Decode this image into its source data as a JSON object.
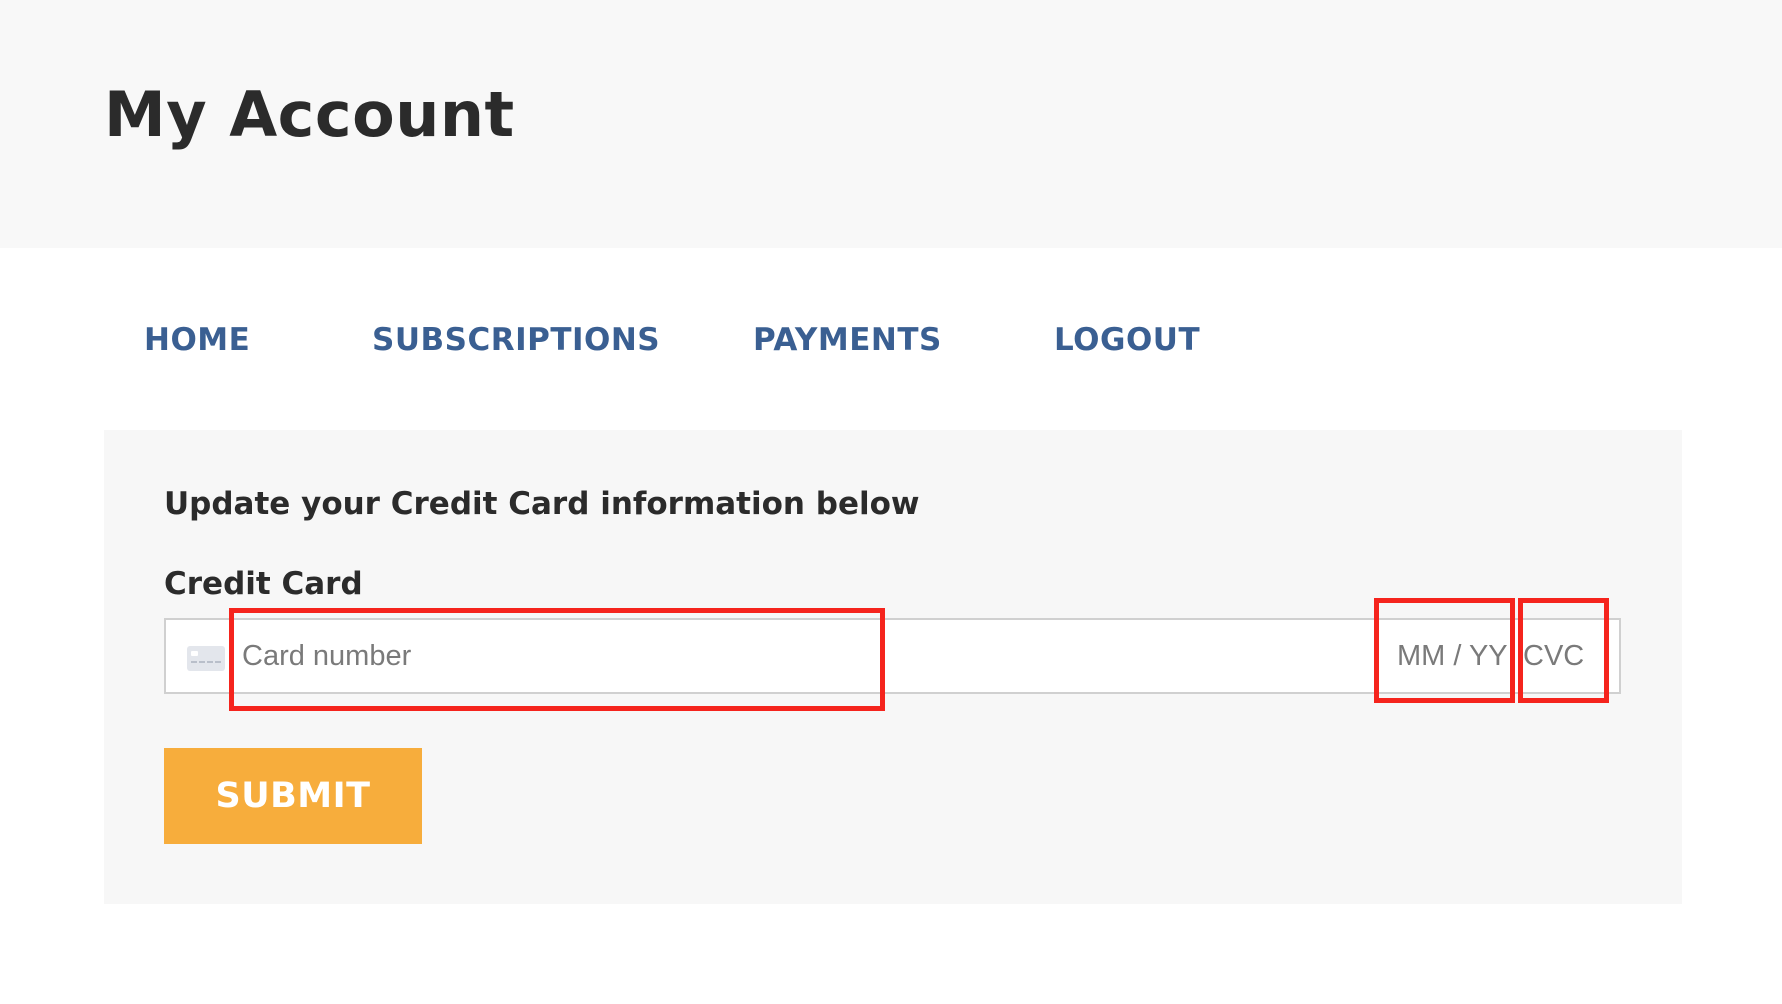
{
  "header": {
    "title": "My Account"
  },
  "nav": {
    "items": [
      {
        "label": "HOME"
      },
      {
        "label": "SUBSCRIPTIONS"
      },
      {
        "label": "PAYMENTS"
      },
      {
        "label": "LOGOUT"
      }
    ]
  },
  "form": {
    "heading": "Update your Credit Card information below",
    "field_label": "Credit Card",
    "card_number_placeholder": "Card number",
    "expiry_placeholder": "MM / YY",
    "cvc_placeholder": "CVC",
    "submit_label": "SUBMIT",
    "card_icon": "credit-card-icon"
  },
  "colors": {
    "nav_link": "#3a5f92",
    "submit_bg": "#f7ad3c",
    "highlight": "#f5241d",
    "header_bg": "#f8f8f8"
  }
}
